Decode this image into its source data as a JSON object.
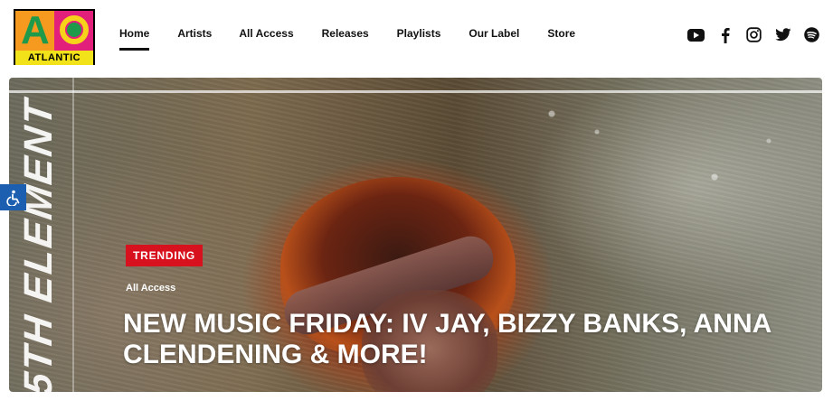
{
  "logo": {
    "wordmark": "ATLANTIC",
    "colors": {
      "orange": "#f59a1f",
      "green": "#1f9a4a",
      "pink": "#e21f7a",
      "yellow": "#f2e21a"
    }
  },
  "nav": {
    "items": [
      {
        "label": "Home",
        "active": true
      },
      {
        "label": "Artists",
        "active": false
      },
      {
        "label": "All Access",
        "active": false
      },
      {
        "label": "Releases",
        "active": false
      },
      {
        "label": "Playlists",
        "active": false
      },
      {
        "label": "Our Label",
        "active": false
      },
      {
        "label": "Store",
        "active": false
      }
    ]
  },
  "social": {
    "icons": [
      "youtube-icon",
      "facebook-icon",
      "instagram-icon",
      "twitter-icon",
      "spotify-icon"
    ]
  },
  "hero": {
    "vertical_text": "5TH ELEMENT",
    "badge": "TRENDING",
    "category": "All Access",
    "headline": "NEW MUSIC FRIDAY: IV JAY, BIZZY BANKS, ANNA CLENDENING & MORE!",
    "badge_color": "#d7121e"
  },
  "accessibility": {
    "icon": "accessibility-icon",
    "color": "#1c5fb0"
  }
}
